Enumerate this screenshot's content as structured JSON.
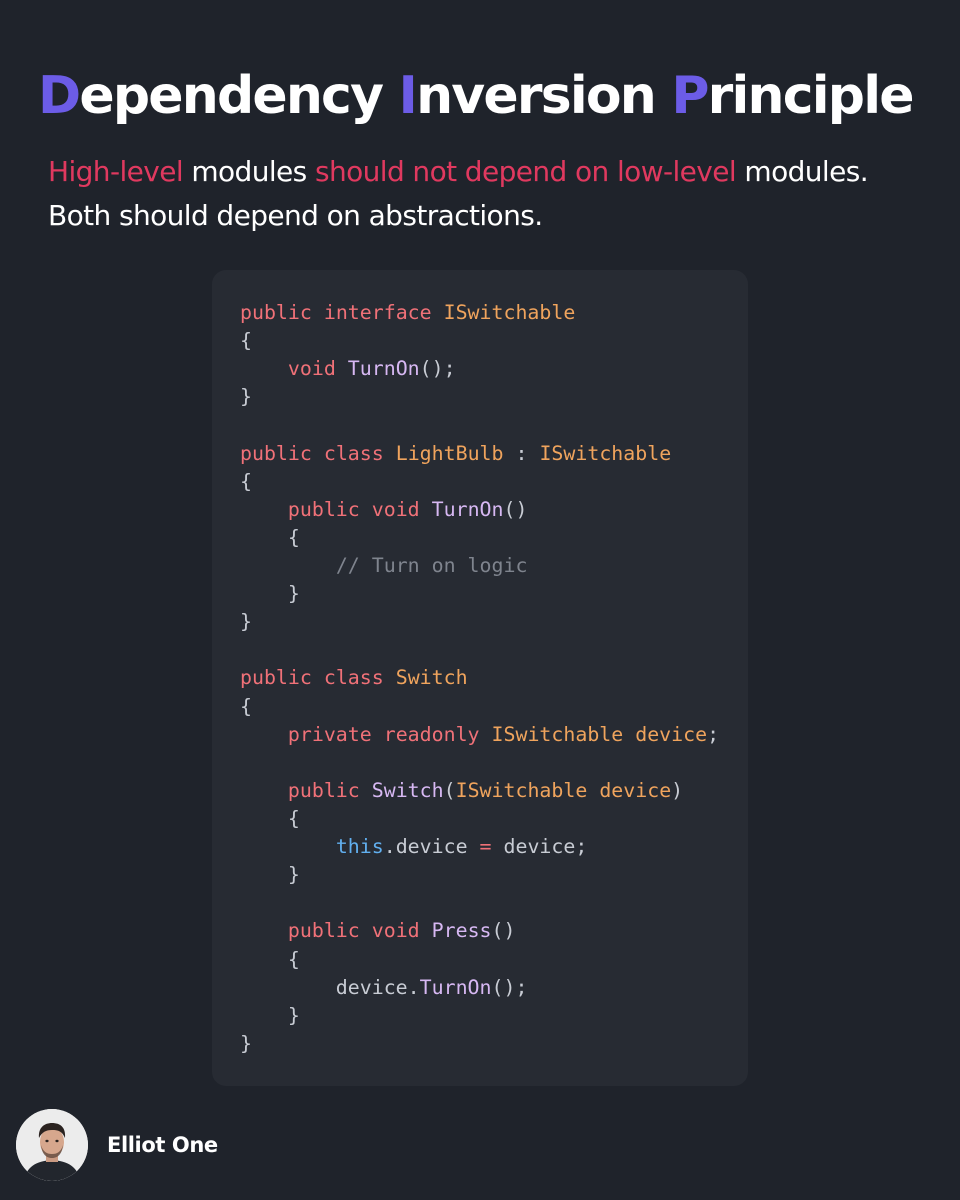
{
  "title": {
    "parts": [
      {
        "initial": "D",
        "rest": "ependency "
      },
      {
        "initial": "I",
        "rest": "nversion "
      },
      {
        "initial": "P",
        "rest": "rinciple"
      }
    ]
  },
  "subtitle": {
    "high_level": "High-level",
    "modules_1": " modules ",
    "should_not": "should not depend on low-level",
    "modules_2": " modules.",
    "line2": "Both should depend on abstractions."
  },
  "code": {
    "language": "csharp",
    "colors": {
      "keyword": "#f07178",
      "type": "#f0a45d",
      "function": "#d7b8f3",
      "this": "#61afef",
      "comment": "#7f848e",
      "plain": "#c8ccd4"
    },
    "lines": [
      [
        {
          "t": "kw",
          "v": "public"
        },
        {
          "t": "plain",
          "v": " "
        },
        {
          "t": "kw",
          "v": "interface"
        },
        {
          "t": "plain",
          "v": " "
        },
        {
          "t": "type",
          "v": "ISwitchable"
        }
      ],
      [
        {
          "t": "plain",
          "v": "{"
        }
      ],
      [
        {
          "t": "plain",
          "v": "    "
        },
        {
          "t": "kw",
          "v": "void"
        },
        {
          "t": "plain",
          "v": " "
        },
        {
          "t": "fn",
          "v": "TurnOn"
        },
        {
          "t": "plain",
          "v": "();"
        }
      ],
      [
        {
          "t": "plain",
          "v": "}"
        }
      ],
      [],
      [
        {
          "t": "kw",
          "v": "public"
        },
        {
          "t": "plain",
          "v": " "
        },
        {
          "t": "kw",
          "v": "class"
        },
        {
          "t": "plain",
          "v": " "
        },
        {
          "t": "type",
          "v": "LightBulb"
        },
        {
          "t": "plain",
          "v": " : "
        },
        {
          "t": "type",
          "v": "ISwitchable"
        }
      ],
      [
        {
          "t": "plain",
          "v": "{"
        }
      ],
      [
        {
          "t": "plain",
          "v": "    "
        },
        {
          "t": "kw",
          "v": "public"
        },
        {
          "t": "plain",
          "v": " "
        },
        {
          "t": "kw",
          "v": "void"
        },
        {
          "t": "plain",
          "v": " "
        },
        {
          "t": "fn",
          "v": "TurnOn"
        },
        {
          "t": "plain",
          "v": "()"
        }
      ],
      [
        {
          "t": "plain",
          "v": "    {"
        }
      ],
      [
        {
          "t": "plain",
          "v": "        "
        },
        {
          "t": "comment",
          "v": "// Turn on logic"
        }
      ],
      [
        {
          "t": "plain",
          "v": "    }"
        }
      ],
      [
        {
          "t": "plain",
          "v": "}"
        }
      ],
      [],
      [
        {
          "t": "kw",
          "v": "public"
        },
        {
          "t": "plain",
          "v": " "
        },
        {
          "t": "kw",
          "v": "class"
        },
        {
          "t": "plain",
          "v": " "
        },
        {
          "t": "type",
          "v": "Switch"
        }
      ],
      [
        {
          "t": "plain",
          "v": "{"
        }
      ],
      [
        {
          "t": "plain",
          "v": "    "
        },
        {
          "t": "kw",
          "v": "private"
        },
        {
          "t": "plain",
          "v": " "
        },
        {
          "t": "kw",
          "v": "readonly"
        },
        {
          "t": "plain",
          "v": " "
        },
        {
          "t": "type",
          "v": "ISwitchable"
        },
        {
          "t": "plain",
          "v": " "
        },
        {
          "t": "type",
          "v": "device"
        },
        {
          "t": "plain",
          "v": ";"
        }
      ],
      [],
      [
        {
          "t": "plain",
          "v": "    "
        },
        {
          "t": "kw",
          "v": "public"
        },
        {
          "t": "plain",
          "v": " "
        },
        {
          "t": "fn",
          "v": "Switch"
        },
        {
          "t": "plain",
          "v": "("
        },
        {
          "t": "type",
          "v": "ISwitchable"
        },
        {
          "t": "plain",
          "v": " "
        },
        {
          "t": "type",
          "v": "device"
        },
        {
          "t": "plain",
          "v": ")"
        }
      ],
      [
        {
          "t": "plain",
          "v": "    {"
        }
      ],
      [
        {
          "t": "plain",
          "v": "        "
        },
        {
          "t": "this",
          "v": "this"
        },
        {
          "t": "plain",
          "v": ".device "
        },
        {
          "t": "op",
          "v": "="
        },
        {
          "t": "plain",
          "v": " device;"
        }
      ],
      [
        {
          "t": "plain",
          "v": "    }"
        }
      ],
      [],
      [
        {
          "t": "plain",
          "v": "    "
        },
        {
          "t": "kw",
          "v": "public"
        },
        {
          "t": "plain",
          "v": " "
        },
        {
          "t": "kw",
          "v": "void"
        },
        {
          "t": "plain",
          "v": " "
        },
        {
          "t": "fn",
          "v": "Press"
        },
        {
          "t": "plain",
          "v": "()"
        }
      ],
      [
        {
          "t": "plain",
          "v": "    {"
        }
      ],
      [
        {
          "t": "plain",
          "v": "        device."
        },
        {
          "t": "fn",
          "v": "TurnOn"
        },
        {
          "t": "plain",
          "v": "();"
        }
      ],
      [
        {
          "t": "plain",
          "v": "    }"
        }
      ],
      [
        {
          "t": "plain",
          "v": "}"
        }
      ]
    ]
  },
  "author": {
    "name": "Elliot One",
    "avatar_icon": "person-avatar"
  },
  "colors": {
    "background": "#1f232b",
    "card": "#272b33",
    "accent_purple": "#6c5ce7",
    "accent_red": "#e0395f"
  }
}
